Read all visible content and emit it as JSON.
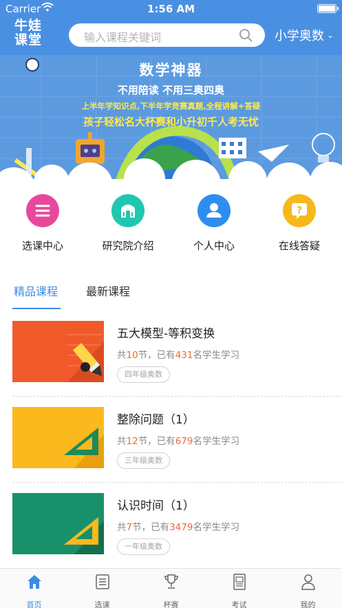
{
  "status_bar": {
    "carrier": "Carrier",
    "time": "1:56 AM"
  },
  "header": {
    "logo_line1": "牛娃",
    "logo_line2": "课堂",
    "search_placeholder": "输入课程关键词",
    "grade_selector": "小学奥数"
  },
  "banner": {
    "title": "数学神器",
    "line2": "不用陪读  不用三奥四奥",
    "line3": "上半年学知识点,下半年学竞赛真题,全程讲解+答疑",
    "line4": "孩子轻松名大杯赛和小升初千人考无忧"
  },
  "entries": [
    {
      "label": "选课中心",
      "color": "#e8489a"
    },
    {
      "label": "研究院介绍",
      "color": "#1fc7b0"
    },
    {
      "label": "个人中心",
      "color": "#2e8ef0"
    },
    {
      "label": "在线答疑",
      "color": "#f7b81c"
    }
  ],
  "tabs": [
    {
      "label": "精品课程",
      "active": true
    },
    {
      "label": "最新课程",
      "active": false
    }
  ],
  "courses": [
    {
      "title": "五大模型-等积变换",
      "prefix": "共",
      "lessons": "10",
      "middle": "节，已有",
      "students": "431",
      "suffix": "名学生学习",
      "tag": "四年级奥数",
      "thumb_color": "#f05a2a",
      "icon": "pencil-icon"
    },
    {
      "title": "整除问题（1）",
      "prefix": "共",
      "lessons": "12",
      "middle": "节，已有",
      "students": "679",
      "suffix": "名学生学习",
      "tag": "三年级奥数",
      "thumb_color": "#fbb91e",
      "icon": "set-square-icon"
    },
    {
      "title": "认识时间（1）",
      "prefix": "共",
      "lessons": "7",
      "middle": "节，已有",
      "students": "3479",
      "suffix": "名学生学习",
      "tag": "一年级奥数",
      "thumb_color": "#18916b",
      "icon": "set-square-icon"
    }
  ],
  "tabbar": [
    {
      "label": "首页",
      "icon": "home-icon",
      "active": true
    },
    {
      "label": "选课",
      "icon": "list-icon",
      "active": false
    },
    {
      "label": "杯赛",
      "icon": "trophy-icon",
      "active": false
    },
    {
      "label": "考试",
      "icon": "exam-paper-icon",
      "active": false
    },
    {
      "label": "我的",
      "icon": "person-icon",
      "active": false
    }
  ]
}
